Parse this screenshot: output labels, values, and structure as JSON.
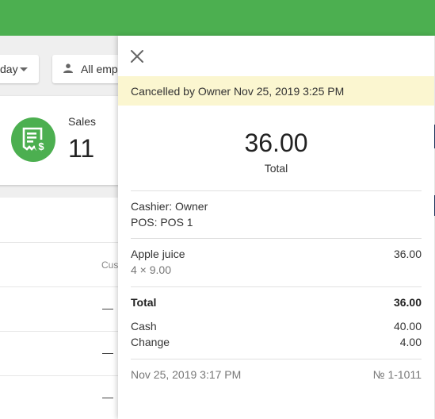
{
  "colors": {
    "brand_green": "#4caf50",
    "banner_bg": "#fbf6d0"
  },
  "background": {
    "date_filter_label": "day",
    "employee_filter_label": "All emp",
    "sales_card": {
      "label": "Sales",
      "value": "11",
      "icon": "receipt-dollar-icon"
    },
    "table": {
      "column_header": "Cus",
      "rows": [
        "—",
        "—",
        "—"
      ]
    }
  },
  "receipt_panel": {
    "close_icon": "close-icon",
    "status_banner": "Cancelled by Owner Nov 25, 2019 3:25 PM",
    "total_amount": "36.00",
    "total_caption": "Total",
    "cashier": "Cashier: Owner",
    "pos": "POS: POS 1",
    "items": [
      {
        "name": "Apple juice",
        "qty_price": "4 × 9.00",
        "amount": "36.00"
      }
    ],
    "summary": {
      "total_label": "Total",
      "total_value": "36.00",
      "cash_label": "Cash",
      "cash_value": "40.00",
      "change_label": "Change",
      "change_value": "4.00"
    },
    "footer": {
      "datetime": "Nov 25, 2019 3:17 PM",
      "receipt_number": "№ 1-1011"
    }
  }
}
